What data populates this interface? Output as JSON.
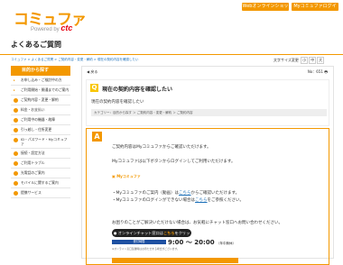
{
  "header": {
    "logo_text": "コミュファ",
    "logo_powered": "Powered by",
    "logo_brand": "ctc",
    "web_shop_btn": "Webオンラインショップ",
    "mycommufa_btn": "Myコミュファログイン",
    "chevron": "›"
  },
  "page_title": "よくあるご質問",
  "breadcrumb": "コミュファ > よくあるご質問 > ご契約内容・変更・解約 > 現在の契約内容を確認したい",
  "font_size": {
    "label": "文字サイズ変更",
    "small": "小",
    "medium": "中",
    "large": "大"
  },
  "sidebar": {
    "heading": "目的から探す",
    "items": [
      {
        "icon": "▸",
        "label": "お申し込み・ご検討中の方"
      },
      {
        "icon": "▸",
        "label": "ご利用開始・開通までのご案内"
      },
      {
        "icon": "●",
        "label": "ご契約内容・変更・解約"
      },
      {
        "icon": "●",
        "label": "料金・お支払い"
      },
      {
        "icon": "●",
        "label": "ご利用中の機器・故障"
      },
      {
        "icon": "●",
        "label": "引っ越し・住所変更"
      },
      {
        "icon": "●",
        "label": "ID・パスワード・Myコミュファ"
      },
      {
        "icon": "●",
        "label": "接続・設定方法"
      },
      {
        "icon": "●",
        "label": "ご利用トラブル"
      },
      {
        "icon": "●",
        "label": "光電話のご案内"
      },
      {
        "icon": "●",
        "label": "モバイルに関するご案内"
      },
      {
        "icon": "●",
        "label": "提携サービス"
      }
    ]
  },
  "main": {
    "back_label": "戻る",
    "back_icon": "◀",
    "faq_no": "No：651",
    "print_icon": "🖶",
    "q_badge": "Q",
    "q_title": "現在の契約内容を確認したい",
    "q_desc": "現在の契約内容を確認したい",
    "category_path": "カテゴリー：目的から探す ＞ ご契約内容・変更・解約 ＞ ご契約内容",
    "a_badge": "A",
    "a_line1": "ご契約内容はMyコミュファからご確認いただけます。",
    "a_line2": "Myコミュファは以下ボタンからログインしてご利用いただけます。",
    "mini_logo": "Myコミュファ",
    "bullet1_pre": "・Myコミュファのご案内（動画）は",
    "bullet1_link": "こちら",
    "bullet1_post": "からご確認いただけます。",
    "bullet2_pre": "・Myコミュファのログインができない場合は",
    "bullet2_link": "こちら",
    "bullet2_post": "をご参照ください。",
    "chat_intro": "お困りのことがご解決いただけない場合は、お気軽にチャット窓口へお問い合わせください。",
    "chat_button_pre": "オンラインチャット窓口は",
    "chat_button_link": "こちら",
    "chat_button_post": "をクリック",
    "hours_label": "受付時間",
    "hours": "9:00 ～ 20:00",
    "hours_note": "（年中無休）",
    "fine_print": "※オンライン窓口混雑時はお待たせする場合がございます。"
  },
  "colors": {
    "brand_orange": "#f39800",
    "link_blue": "#1b6fb8",
    "badge_yellow": "#f9c600"
  }
}
